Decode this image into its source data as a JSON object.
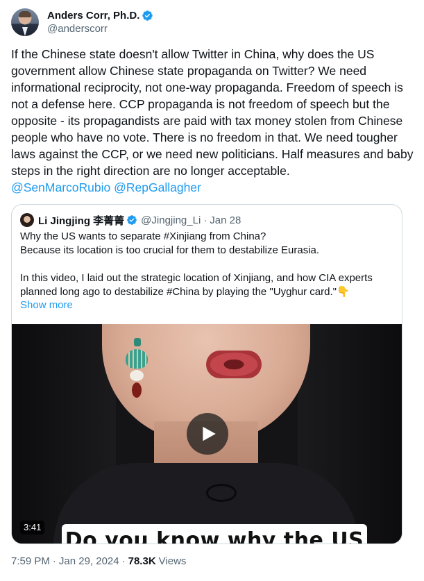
{
  "author": {
    "display_name": "Anders Corr, Ph.D.",
    "handle": "@anderscorr",
    "verified": true
  },
  "tweet": {
    "text": "If the Chinese state doesn't allow Twitter in China, why does the US government allow Chinese state propaganda on Twitter? We need informational reciprocity, not one-way propaganda. Freedom of speech is not a defense here. CCP propaganda is not freedom of speech but the opposite - its propagandists are paid with tax money stolen from Chinese people who have no vote. There is no freedom in that. We need tougher laws against the CCP, or we need new politicians. Half measures and baby steps in the right direction are no longer acceptable.",
    "mentions": [
      "@SenMarcoRubio",
      "@RepGallagher"
    ]
  },
  "quoted_tweet": {
    "display_name": "Li Jingjing 李菁菁",
    "handle": "@Jingjing_Li",
    "date": "Jan 28",
    "separator": "·",
    "lines": [
      "Why the US wants to separate #Xinjiang from China?",
      "Because its location is too crucial for them to destabilize Eurasia.",
      "",
      "In this video, I laid out the strategic location of Xinjiang, and how CIA experts",
      "planned long ago to destabilize #China by playing the \"Uyghur card.\"👇"
    ],
    "show_more": "Show more",
    "video": {
      "duration": "3:41",
      "caption": "Do you know why the US"
    }
  },
  "meta": {
    "time": "7:59 PM",
    "date": "Jan 29, 2024",
    "separator": "·",
    "views_count": "78.3K",
    "views_label": "Views"
  },
  "colors": {
    "link": "#1d9bf0",
    "secondary_text": "#536471",
    "primary_text": "#0f1419",
    "border": "#cfd9de"
  },
  "icons": [
    "verified-badge-icon",
    "play-icon"
  ]
}
